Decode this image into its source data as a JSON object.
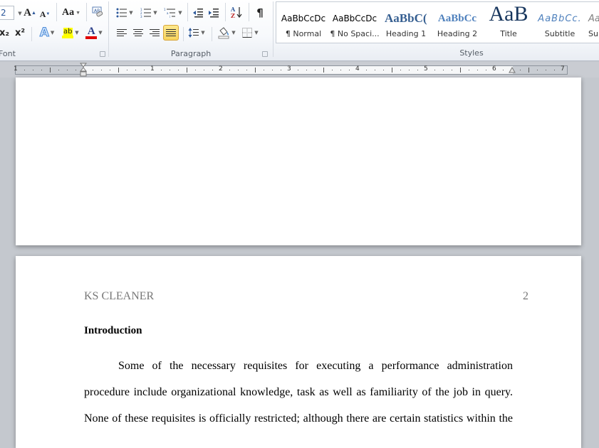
{
  "ribbon": {
    "font_group": {
      "label": "Font",
      "font_size_value": "2",
      "buttons": {
        "grow_font": "A",
        "shrink_font": "A",
        "change_case": "Aa",
        "subscript": "x₂",
        "superscript": "x²",
        "text_effects": "A",
        "highlight": "ab",
        "font_color": "A"
      },
      "colors": {
        "highlight": "#ffff00",
        "font_color": "#e00000",
        "text_effects": "#4a8ad8"
      }
    },
    "paragraph_group": {
      "label": "Paragraph",
      "show_marks": "¶",
      "sort": "A↓",
      "active_alignment": "justify"
    },
    "styles_group": {
      "label": "Styles",
      "items": [
        {
          "sample": "AaBbCcDc",
          "name": "¶ Normal"
        },
        {
          "sample": "AaBbCcDc",
          "name": "¶ No Spaci..."
        },
        {
          "sample": "AaBbC(",
          "name": "Heading 1"
        },
        {
          "sample": "AaBbCc",
          "name": "Heading 2"
        },
        {
          "sample": "AaB",
          "name": "Title"
        },
        {
          "sample": "AaBbCc.",
          "name": "Subtitle"
        },
        {
          "sample": "Aa",
          "name": "Sul"
        }
      ]
    }
  },
  "ruler": {
    "numbers": [
      "1",
      "1",
      "2",
      "3",
      "4",
      "5",
      "6",
      "7"
    ]
  },
  "document": {
    "page2": {
      "running_head": "KS CLEANER",
      "page_number": "2",
      "heading": "Introduction",
      "lines": [
        "Some of the necessary requisites for executing a performance administration",
        "procedure include organizational knowledge, task as well as familiarity of the job in query.",
        "None of these requisites is officially restricted; although there are certain statistics within the"
      ]
    }
  }
}
